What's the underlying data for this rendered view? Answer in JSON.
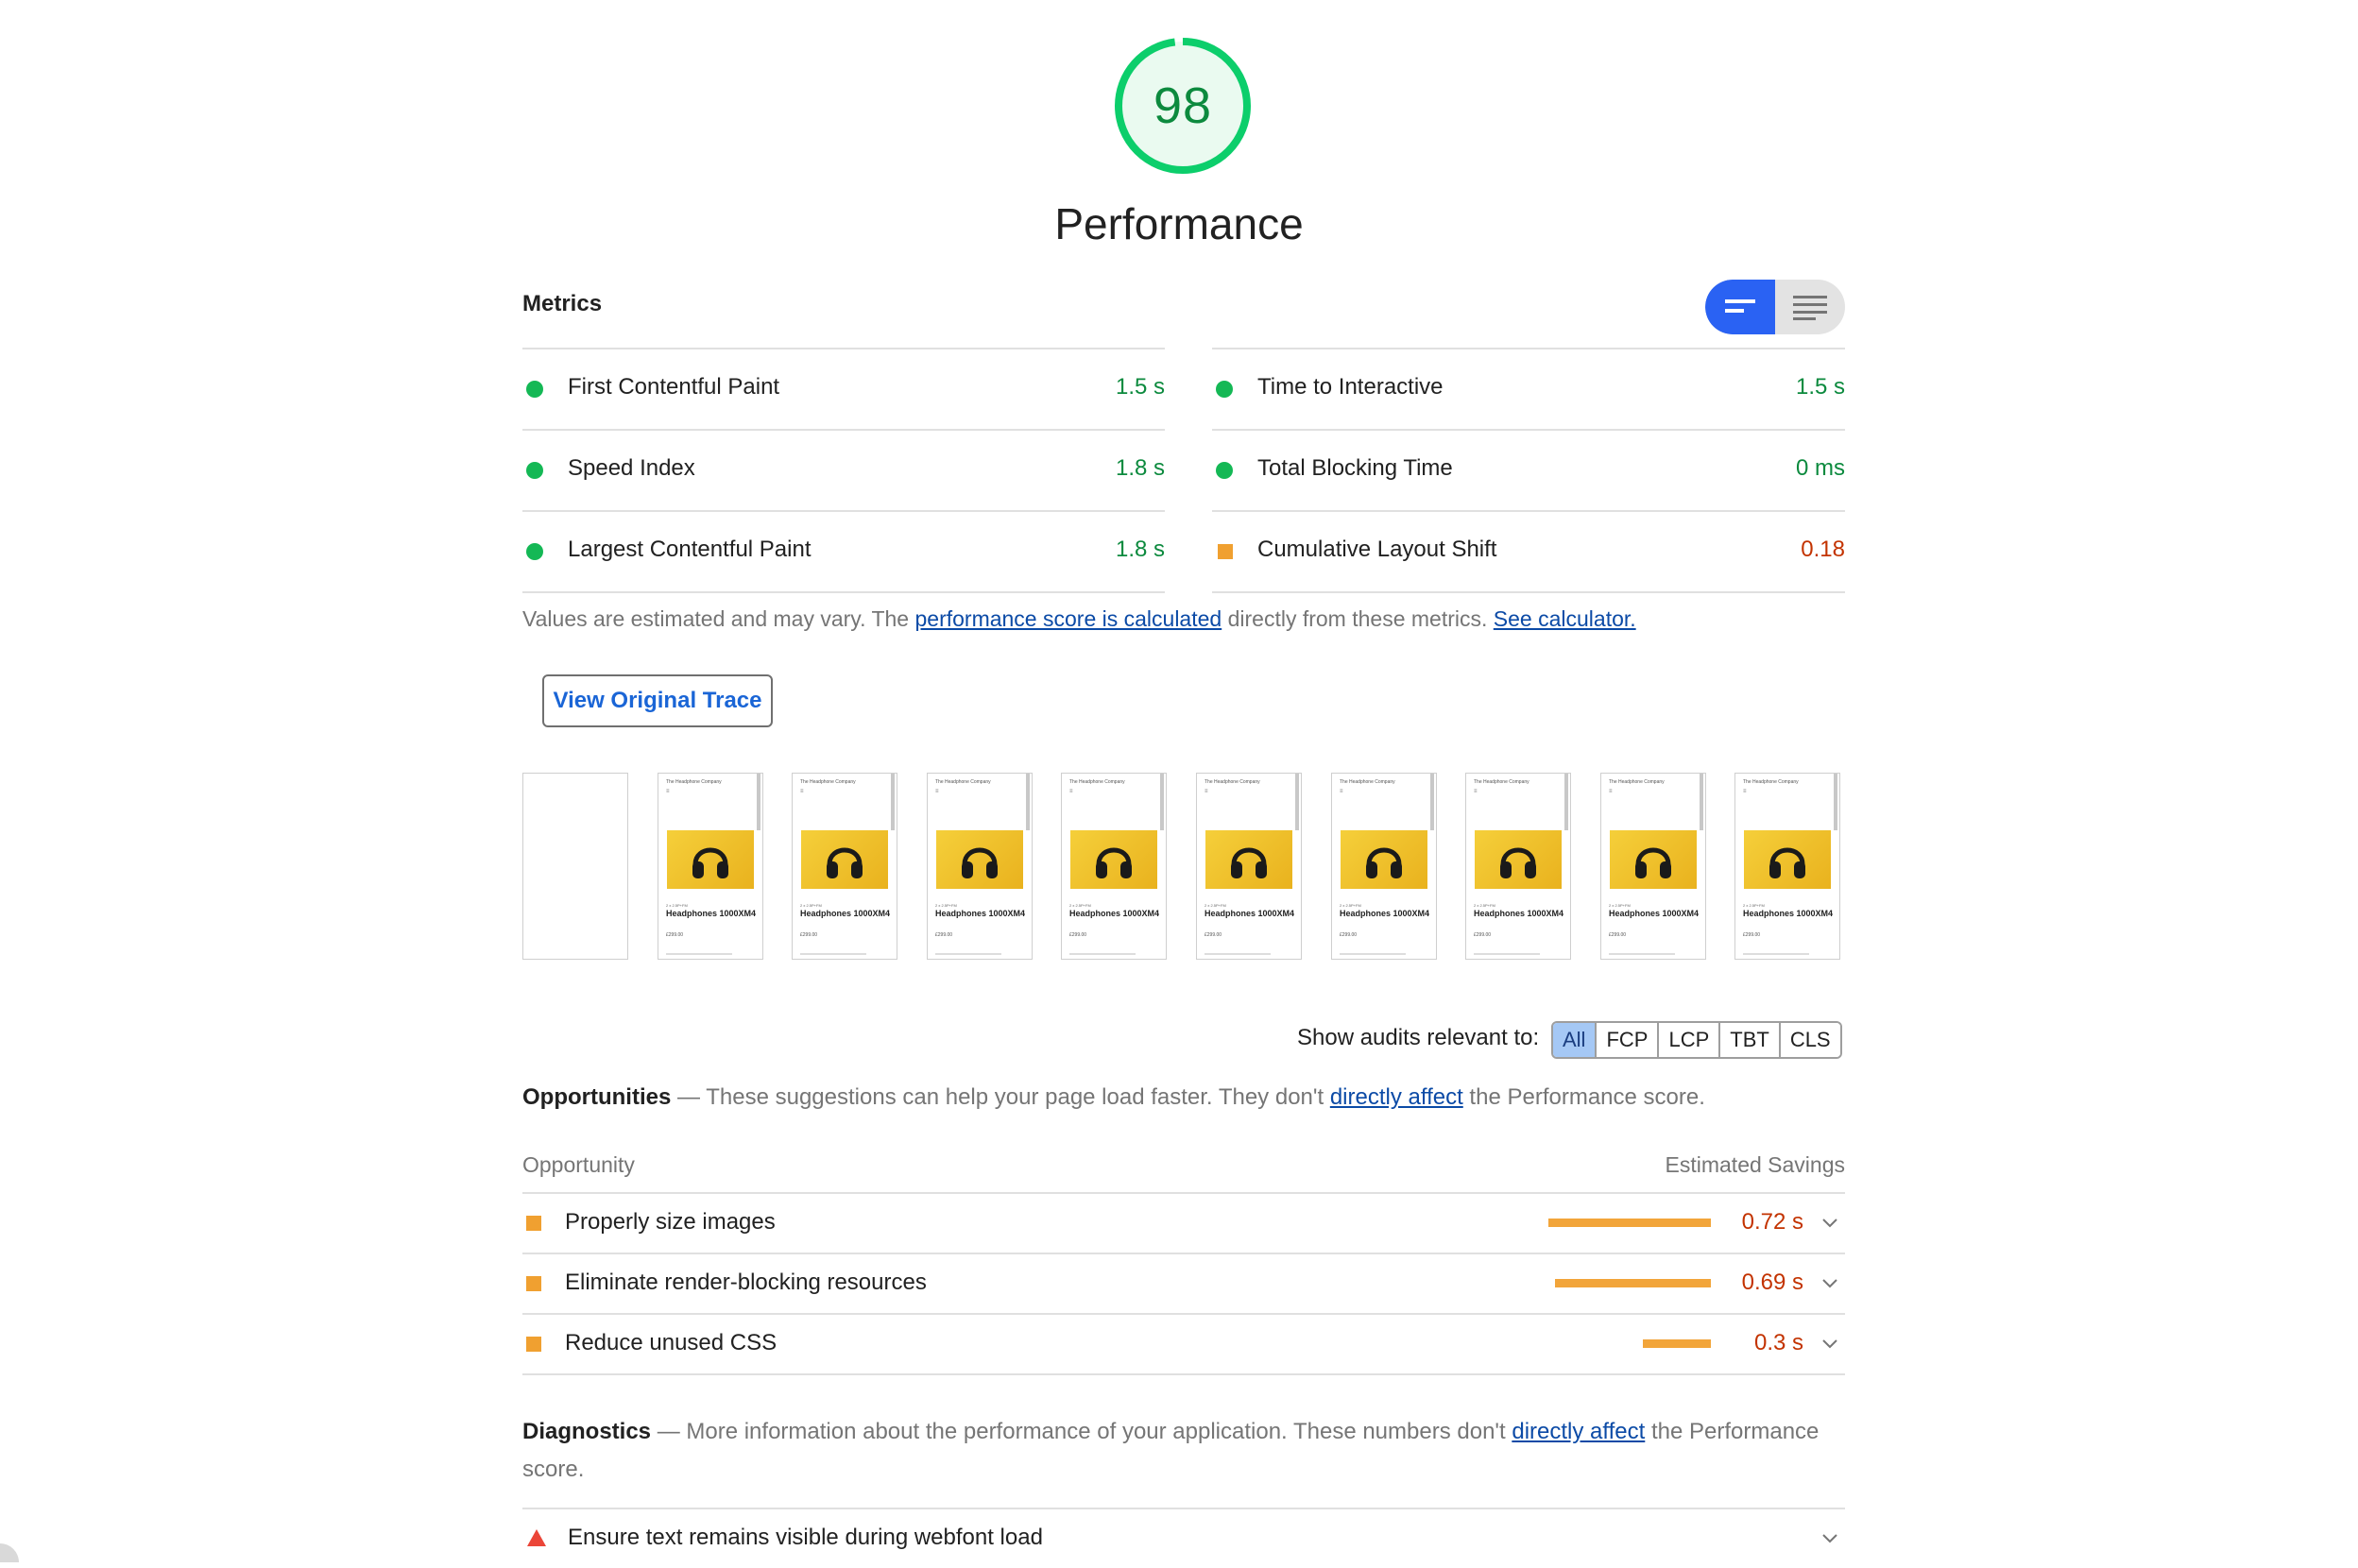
{
  "gauge": {
    "score": "98",
    "title": "Performance",
    "fraction": 0.98,
    "color": "#0cce6b"
  },
  "metrics": {
    "heading": "Metrics",
    "toggle": {
      "options": [
        "bars-view-icon",
        "list-view-icon"
      ],
      "selected": "bars-view-icon"
    },
    "left": [
      {
        "label": "First Contentful Paint",
        "value": "1.5 s",
        "status": "pass"
      },
      {
        "label": "Speed Index",
        "value": "1.8 s",
        "status": "pass"
      },
      {
        "label": "Largest Contentful Paint",
        "value": "1.8 s",
        "status": "pass"
      }
    ],
    "right": [
      {
        "label": "Time to Interactive",
        "value": "1.5 s",
        "status": "pass"
      },
      {
        "label": "Total Blocking Time",
        "value": "0 ms",
        "status": "pass"
      },
      {
        "label": "Cumulative Layout Shift",
        "value": "0.18",
        "status": "average"
      }
    ],
    "note": {
      "before": "Values are estimated and may vary. The ",
      "link1": "performance score is calculated",
      "middle": " directly from these metrics. ",
      "link2": "See calculator."
    }
  },
  "trace_button": "View Original Trace",
  "filmstrip": {
    "frames": 10,
    "site_name": "The Headphone Company",
    "menu": "≡",
    "tag": "2 x 2.5P+FM",
    "product": "Headphones 1000XM4",
    "price": "£299.00"
  },
  "filter": {
    "label": "Show audits relevant to:",
    "options": [
      "All",
      "FCP",
      "LCP",
      "TBT",
      "CLS"
    ],
    "selected": "All"
  },
  "opportunities": {
    "title": "Opportunities",
    "dash": " — ",
    "desc_before": "These suggestions can help your page load faster. They don't ",
    "desc_link": "directly affect",
    "desc_after": " the Performance score.",
    "col_left": "Opportunity",
    "col_right": "Estimated Savings",
    "items": [
      {
        "label": "Properly size images",
        "value": "0.72 s",
        "savings": 0.72
      },
      {
        "label": "Eliminate render-blocking resources",
        "value": "0.69 s",
        "savings": 0.69
      },
      {
        "label": "Reduce unused CSS",
        "value": "0.3 s",
        "savings": 0.3
      }
    ]
  },
  "diagnostics": {
    "title": "Diagnostics",
    "dash": " — ",
    "desc_before": "More information about the performance of your application. These numbers don't ",
    "desc_link": "directly affect",
    "desc_after": " the Performance score.",
    "items": [
      {
        "label": "Ensure text remains visible during webfont load",
        "status": "fail"
      }
    ]
  },
  "colors": {
    "pass": "#0cce6b",
    "average": "#ffa400",
    "fail": "#ff4e42",
    "link": "#0b4aa6",
    "accent": "#2a62f3"
  }
}
